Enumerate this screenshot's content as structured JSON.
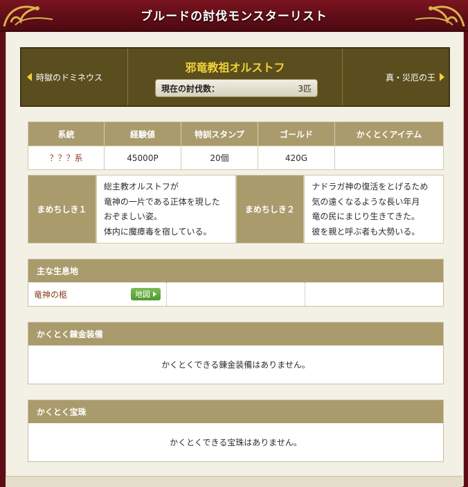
{
  "header": {
    "title": "ブルードの討伐モンスターリスト"
  },
  "nav": {
    "prev_label": "時獄のドミネウス",
    "next_label": "真・災厄の王",
    "monster_name": "邪竜教祖オルストフ",
    "count_label": "現在の討伐数：",
    "count_value": "3匹"
  },
  "stats": {
    "headers": [
      "系統",
      "経験値",
      "特訓スタンプ",
      "ゴールド",
      "かくとくアイテム"
    ],
    "values": [
      "？？？系",
      "45000P",
      "20個",
      "420G",
      ""
    ]
  },
  "trivia": [
    {
      "title": "まめちしき１",
      "lines": [
        "総主教オルストフが",
        "竜神の一片である正体を現した",
        "おぞましい姿。",
        "体内に魔瘴毒を宿している。"
      ]
    },
    {
      "title": "まめちしき２",
      "lines": [
        "ナドラガ神の復活をとげるため",
        "気の遠くなるような長い年月",
        "竜の民にまじり生きてきた。",
        "彼を親と呼ぶ者も大勢いる。"
      ]
    }
  ],
  "habitat": {
    "title": "主な生息地",
    "location": "竜神の柩",
    "map_button": "地図"
  },
  "equipment": {
    "title": "かくとく錬金装備",
    "empty_message": "かくとくできる錬金装備はありません。"
  },
  "gems": {
    "title": "かくとく宝珠",
    "empty_message": "かくとくできる宝珠はありません。"
  },
  "colors": {
    "header_bg": "#5e0d16",
    "nav_bg": "#5b4e1e",
    "accent_gold": "#f2d23a",
    "table_head": "#a99b6c"
  }
}
